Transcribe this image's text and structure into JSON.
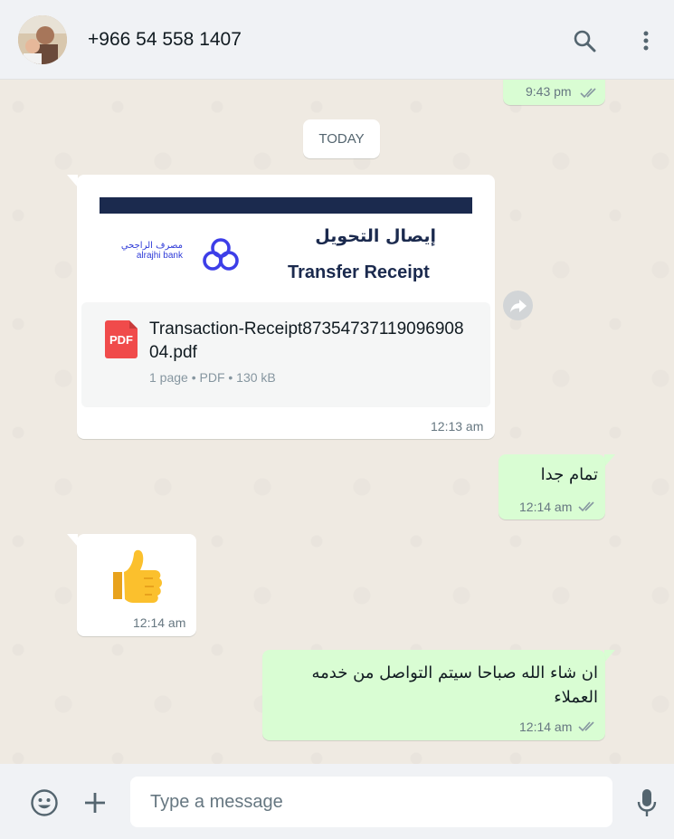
{
  "header": {
    "contact_name": "+966 54 558 1407"
  },
  "chat": {
    "prev_message_time": "9:43 pm",
    "date_divider": "TODAY",
    "document_message": {
      "preview_title_ar": "إيصال التحويل",
      "preview_title_en": "Transfer Receipt",
      "bank_name_ar": "مصرف الراجحي",
      "bank_name_en": "alrajhi bank",
      "file_icon_label": "PDF",
      "file_name": "Transaction-Receipt8735473711909690804.pdf",
      "file_meta": "1 page • PDF • 130 kB",
      "time": "12:13 am"
    },
    "message_2": {
      "text": "تمام جدا",
      "time": "12:14 am"
    },
    "message_3": {
      "emoji": "👍",
      "time": "12:14 am"
    },
    "message_4": {
      "text": "ان شاء الله صباحا سيتم التواصل من خدمه العملاء",
      "time": "12:14 am"
    }
  },
  "footer": {
    "input_placeholder": "Type a message"
  },
  "colors": {
    "outgoing_bubble": "#d9fdd3",
    "incoming_bubble": "#ffffff",
    "chat_background": "#efeae2",
    "read_ticks": "#8696a0",
    "pdf_red": "#f04b4b",
    "bank_navy": "#1b2a4e",
    "bank_blue": "#3d3ee8"
  },
  "icons": {
    "search": "search-icon",
    "menu": "kebab-menu-icon",
    "forward": "forward-icon",
    "emoji": "emoji-icon",
    "attach": "plus-icon",
    "mic": "microphone-icon"
  }
}
